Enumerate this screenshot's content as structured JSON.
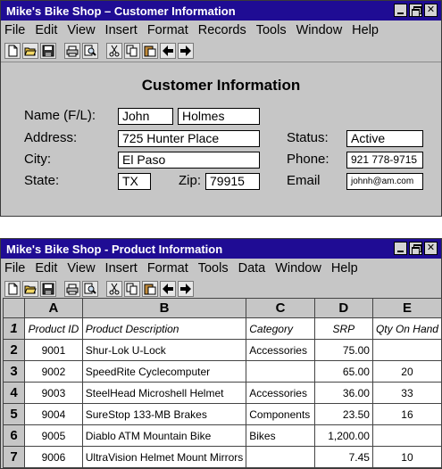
{
  "customer_window": {
    "title": "Mike's Bike Shop – Customer Information",
    "menu": [
      "File",
      "Edit",
      "View",
      "Insert",
      "Format",
      "Records",
      "Tools",
      "Window",
      "Help"
    ],
    "form_title": "Customer Information",
    "labels": {
      "name": "Name (F/L):",
      "address": "Address:",
      "city": "City:",
      "state": "State:",
      "zip": "Zip:",
      "status": "Status:",
      "phone": "Phone:",
      "email": "Email"
    },
    "values": {
      "first_name": "John",
      "last_name": "Holmes",
      "address": "725 Hunter Place",
      "city": "El Paso",
      "state": "TX",
      "zip": "79915",
      "status": "Active",
      "phone": "921 778-9715",
      "email": "johnh@am.com"
    }
  },
  "product_window": {
    "title": "Mike's Bike Shop - Product Information",
    "menu": [
      "File",
      "Edit",
      "View",
      "Insert",
      "Format",
      "Tools",
      "Data",
      "Window",
      "Help"
    ],
    "columns": [
      "A",
      "B",
      "C",
      "D",
      "E"
    ],
    "rows": [
      {
        "num": "1",
        "cells": [
          "Product ID",
          "Product Description",
          "Category",
          "SRP",
          "Qty On Hand"
        ]
      },
      {
        "num": "2",
        "cells": [
          "9001",
          "Shur-Lok U-Lock",
          "Accessories",
          "75.00",
          ""
        ]
      },
      {
        "num": "3",
        "cells": [
          "9002",
          "SpeedRite Cyclecomputer",
          "",
          "65.00",
          "20"
        ]
      },
      {
        "num": "4",
        "cells": [
          "9003",
          "SteelHead Microshell Helmet",
          "Accessories",
          "36.00",
          "33"
        ]
      },
      {
        "num": "5",
        "cells": [
          "9004",
          "SureStop 133-MB Brakes",
          "Components",
          "23.50",
          "16"
        ]
      },
      {
        "num": "6",
        "cells": [
          "9005",
          "Diablo ATM Mountain Bike",
          "Bikes",
          "1,200.00",
          ""
        ]
      },
      {
        "num": "7",
        "cells": [
          "9006",
          "UltraVision Helmet Mount Mirrors",
          "",
          "7.45",
          "10"
        ]
      }
    ]
  },
  "toolbar_icons": [
    "new-icon",
    "open-icon",
    "save-icon",
    "print-icon",
    "print-preview-icon",
    "cut-icon",
    "copy-icon",
    "paste-icon",
    "back-arrow-icon",
    "forward-arrow-icon"
  ],
  "colors": {
    "titlebar": "#1f0c94",
    "window_bg": "#c6c6c6"
  }
}
